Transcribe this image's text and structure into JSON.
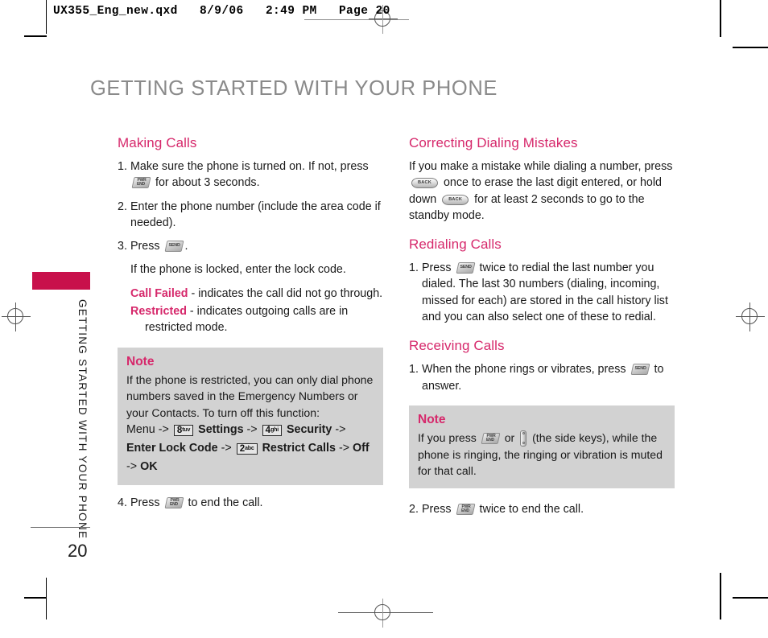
{
  "print_marks": {
    "slug": "UX355_Eng_new.qxd   8/9/06   2:49 PM   Page 20",
    "reg_mark_name": "registration-mark"
  },
  "page": {
    "title": "GETTING STARTED WITH YOUR PHONE",
    "side_tab_text": "GETTING STARTED WITH YOUR PHONE",
    "page_number": "20",
    "accent_color": "#d6286b",
    "tab_color": "#c8104b",
    "title_color": "#8a8a8a",
    "note_bg_color": "#d2d2d2"
  },
  "icons": {
    "end_key": "END",
    "end_key_top": "PWR",
    "send_key": "SEND",
    "back_key": "BACK",
    "side_key": "side-key"
  },
  "left_column": {
    "section1": {
      "heading": "Making Calls",
      "step1_num": "1.",
      "step1_a": "Make sure the phone is turned on. If not, press",
      "step1_b": "for about 3 seconds.",
      "step2_num": "2.",
      "step2": "Enter the phone number (include the area code if needed).",
      "step3_num": "3.",
      "step3_a": "Press",
      "step3_b": ".",
      "locked_note": "If the phone is locked, enter the lock code.",
      "call_failed_label": "Call Failed",
      "call_failed_text": "- indicates the call did not go through.",
      "restricted_label": "Restricted",
      "restricted_text": "- indicates outgoing calls are in",
      "restricted_text2": "restricted mode.",
      "step4_num": "4.",
      "step4_a": "Press",
      "step4_b": "to end the call."
    },
    "note": {
      "title": "Note",
      "body": "If the phone is restricted, you can only dial phone numbers saved in the Emergency Numbers or your Contacts. To turn off this function:",
      "path": {
        "menu": "Menu",
        "arrow": "->",
        "key8_digit": "8",
        "key8_letters": "tuv",
        "settings": "Settings",
        "key4_digit": "4",
        "key4_letters": "ghi",
        "security": "Security",
        "enter_lock_code": "Enter Lock Code",
        "key2_digit": "2",
        "key2_letters": "abc",
        "restrict_calls": "Restrict Calls",
        "off": "Off",
        "ok": "OK"
      }
    }
  },
  "right_column": {
    "section1": {
      "heading": "Correcting Dialing Mistakes",
      "text_a": "If you make a mistake while dialing a number, press",
      "text_b": "once to erase the last digit entered, or hold down",
      "text_c": "for at least 2 seconds to go to the standby mode."
    },
    "section2": {
      "heading": "Redialing Calls",
      "step1_num": "1.",
      "step1_a": "Press",
      "step1_b": "twice to redial the last number you dialed. The last 30 numbers (dialing, incoming, missed for each) are stored in the call history list and you can also select one of these to redial."
    },
    "section3": {
      "heading": "Receiving Calls",
      "step1_num": "1.",
      "step1_a": "When the phone rings or vibrates, press",
      "step1_b": "to answer.",
      "step2_num": "2.",
      "step2_a": "Press",
      "step2_b": "twice to end the call."
    },
    "note": {
      "title": "Note",
      "text_a": "If you press",
      "text_or": "or",
      "text_b": "(the side keys), while the phone is ringing, the ringing or vibration is muted for that call."
    }
  }
}
